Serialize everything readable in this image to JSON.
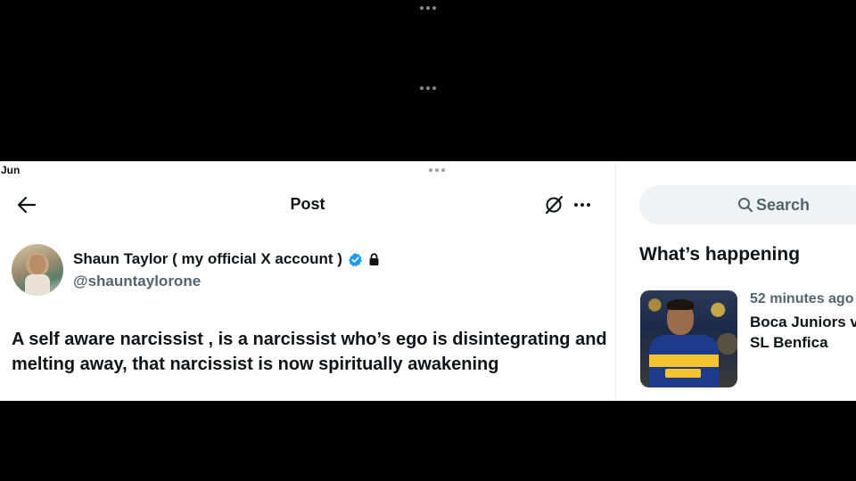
{
  "status": {
    "time_fragment": "Jun"
  },
  "post_view": {
    "header_title": "Post",
    "author": {
      "display_name": "Shaun Taylor ( my official X account )",
      "handle": "@shauntaylorone",
      "verified": true,
      "protected": true
    },
    "text": "A self aware narcissist , is a narcissist who’s ego is disintegrating and melting away, that narcissist is now spiritually awakening"
  },
  "sidebar": {
    "search_placeholder": "Search",
    "section_title": "What’s happening",
    "trend": {
      "meta": "52 minutes ago",
      "title": "Boca Juniors v\nSL Benfica"
    }
  },
  "colors": {
    "verified_blue": "#1d9bf0",
    "text": "#0f1419",
    "muted": "#536471"
  }
}
